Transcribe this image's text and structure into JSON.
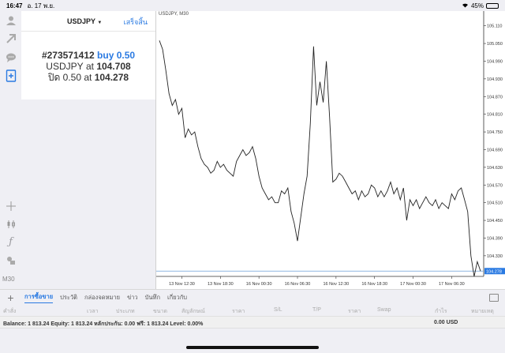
{
  "status": {
    "time": "16:47",
    "date": "อ. 17 พ.ย.",
    "battery": "45%",
    "battery_level": 0.45
  },
  "order_panel": {
    "symbol": "USDJPY",
    "done_label": "เสร็จสิ้น",
    "ticket": "#273571412",
    "action": "buy 0.50",
    "open_symbol": "USDJPY",
    "open_at_word": "at",
    "open_price": "104.708",
    "close_label": "ปิด 0.50",
    "close_at_word": "at",
    "close_price": "104.278"
  },
  "chart_data": {
    "type": "line",
    "title": "USDJPY, M30",
    "ylim": [
      104.26,
      105.16
    ],
    "yticks": [
      "105.110",
      "105.050",
      "104.990",
      "104.930",
      "104.870",
      "104.810",
      "104.750",
      "104.690",
      "104.630",
      "104.570",
      "104.510",
      "104.450",
      "104.390",
      "104.330"
    ],
    "yticks_values": [
      105.11,
      105.05,
      104.99,
      104.93,
      104.87,
      104.81,
      104.75,
      104.69,
      104.63,
      104.57,
      104.51,
      104.45,
      104.39,
      104.33
    ],
    "xticks": [
      "13 Nov 12:30",
      "13 Nov 18:30",
      "16 Nov 00:30",
      "16 Nov 06:30",
      "16 Nov 12:30",
      "16 Nov 18:30",
      "17 Nov 00:30",
      "17 Nov 06:30"
    ],
    "xticks_index": [
      7,
      19,
      31,
      43,
      55,
      67,
      79,
      91
    ],
    "current_price": "104.278",
    "current_value": 104.278,
    "grid": false,
    "values": [
      105.06,
      105.03,
      104.96,
      104.88,
      104.84,
      104.86,
      104.81,
      104.83,
      104.73,
      104.76,
      104.74,
      104.75,
      104.7,
      104.66,
      104.64,
      104.63,
      104.61,
      104.62,
      104.65,
      104.63,
      104.64,
      104.62,
      104.61,
      104.6,
      104.65,
      104.67,
      104.69,
      104.67,
      104.68,
      104.7,
      104.66,
      104.6,
      104.56,
      104.54,
      104.52,
      104.53,
      104.51,
      104.51,
      104.55,
      104.54,
      104.56,
      104.48,
      104.44,
      104.38,
      104.46,
      104.54,
      104.6,
      104.78,
      105.04,
      104.84,
      104.92,
      104.85,
      104.99,
      104.8,
      104.58,
      104.59,
      104.61,
      104.6,
      104.58,
      104.56,
      104.54,
      104.55,
      104.52,
      104.55,
      104.53,
      104.54,
      104.57,
      104.56,
      104.53,
      104.55,
      104.53,
      104.55,
      104.58,
      104.54,
      104.56,
      104.52,
      104.56,
      104.45,
      104.52,
      104.5,
      104.52,
      104.49,
      104.51,
      104.53,
      104.51,
      104.5,
      104.52,
      104.49,
      104.51,
      104.5,
      104.49,
      104.54,
      104.52,
      104.55,
      104.56,
      104.52,
      104.48,
      104.33,
      104.26,
      104.31,
      104.278
    ]
  },
  "tabs": [
    {
      "label": "การซื้อขาย",
      "active": true
    },
    {
      "label": "ประวัติ",
      "active": false
    },
    {
      "label": "กล่องจดหมาย",
      "active": false
    },
    {
      "label": "ข่าว",
      "active": false
    },
    {
      "label": "บันทึก",
      "active": false
    },
    {
      "label": "เกี่ยวกับ",
      "active": false
    }
  ],
  "timeframe": "M30",
  "columns": [
    "คำสั่ง",
    "เวลา",
    "ประเภท",
    "ขนาด",
    "สัญลักษณ์",
    "ราคา",
    "S/L",
    "T/P",
    "ราคา",
    "Swap",
    "กำไร",
    "หมายเหตุ"
  ],
  "balance": {
    "text": "Balance: 1 813.24 Equity: 1 813.24 หลักประกัน: 0.00 ฟรี: 1 813.24 Level: 0.00%",
    "amount": "0.00  USD"
  },
  "colors": {
    "accent": "#2a7ae2",
    "line": "#222222",
    "current_line": "#6a9fd8"
  }
}
